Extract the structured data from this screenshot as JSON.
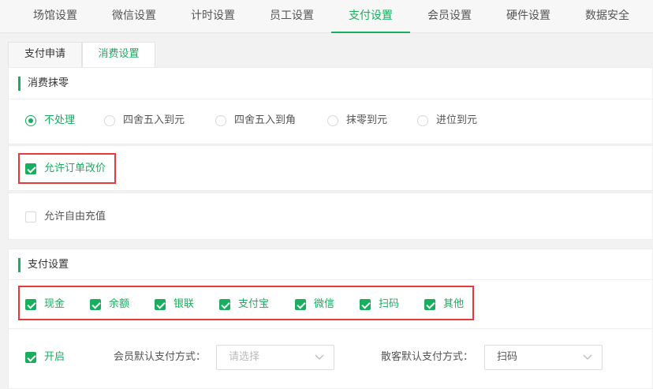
{
  "top_tabs": [
    "场馆设置",
    "微信设置",
    "计时设置",
    "员工设置",
    "支付设置",
    "会员设置",
    "硬件设置",
    "数据安全"
  ],
  "active_top_tab": "支付设置",
  "sub_tabs": [
    "支付申请",
    "消费设置"
  ],
  "active_sub_tab": "消费设置",
  "rounding": {
    "title": "消费抹零",
    "options": [
      "不处理",
      "四舍五入到元",
      "四舍五入到角",
      "抹零到元",
      "进位到元"
    ],
    "selected": "不处理"
  },
  "allow_order_price_change": {
    "label": "允许订单改价",
    "checked": true
  },
  "allow_free_recharge": {
    "label": "允许自由充值",
    "checked": false
  },
  "payment": {
    "title": "支付设置",
    "methods": [
      {
        "label": "现金",
        "checked": true
      },
      {
        "label": "余额",
        "checked": true
      },
      {
        "label": "银联",
        "checked": true
      },
      {
        "label": "支付宝",
        "checked": true
      },
      {
        "label": "微信",
        "checked": true
      },
      {
        "label": "扫码",
        "checked": true
      },
      {
        "label": "其他",
        "checked": true
      }
    ],
    "enable": {
      "label": "开启",
      "checked": true
    },
    "member_default_label": "会员默认支付方式：",
    "member_default_placeholder": "请选择",
    "guest_default_label": "散客默认支付方式：",
    "guest_default_value": "扫码"
  },
  "colors": {
    "accent": "#1aad5f",
    "highlight": "#e5393a"
  }
}
